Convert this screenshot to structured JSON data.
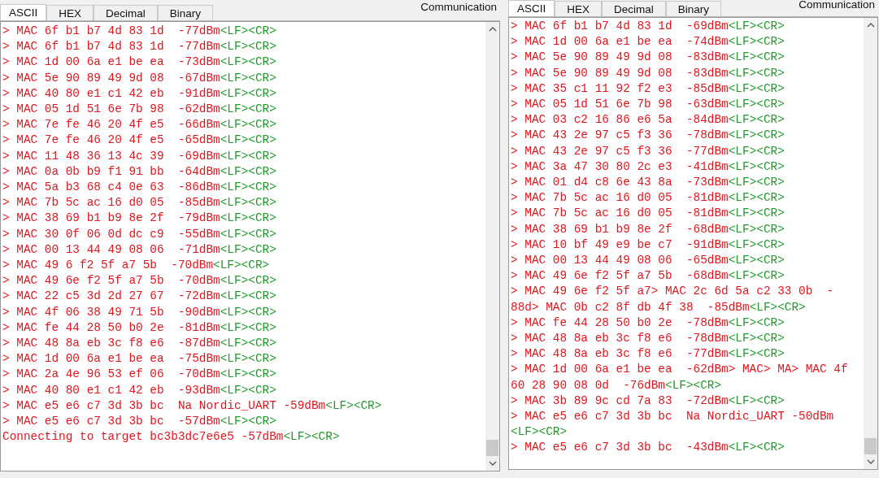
{
  "panels": [
    {
      "tabs": [
        {
          "label": "ASCII",
          "selected": true
        },
        {
          "label": "HEX",
          "selected": false
        },
        {
          "label": "Decimal",
          "selected": false
        },
        {
          "label": "Binary",
          "selected": false
        }
      ],
      "label": "Communication",
      "lines": [
        {
          "text": "> MAC 6f b1 b7 4d 83 1d  -77dBm",
          "end": "<LF><CR>"
        },
        {
          "text": "> MAC 6f b1 b7 4d 83 1d  -77dBm",
          "end": "<LF><CR>"
        },
        {
          "text": "> MAC 1d 00 6a e1 be ea  -73dBm",
          "end": "<LF><CR>"
        },
        {
          "text": "> MAC 5e 90 89 49 9d 08  -67dBm",
          "end": "<LF><CR>"
        },
        {
          "text": "> MAC 40 80 e1 c1 42 eb  -91dBm",
          "end": "<LF><CR>"
        },
        {
          "text": "> MAC 05 1d 51 6e 7b 98  -62dBm",
          "end": "<LF><CR>"
        },
        {
          "text": "> MAC 7e fe 46 20 4f e5  -66dBm",
          "end": "<LF><CR>"
        },
        {
          "text": "> MAC 7e fe 46 20 4f e5  -65dBm",
          "end": "<LF><CR>"
        },
        {
          "text": "> MAC 11 48 36 13 4c 39  -69dBm",
          "end": "<LF><CR>"
        },
        {
          "text": "> MAC 0a 0b b9 f1 91 bb  -64dBm",
          "end": "<LF><CR>"
        },
        {
          "text": "> MAC 5a b3 68 c4 0e 63  -86dBm",
          "end": "<LF><CR>"
        },
        {
          "text": "> MAC 7b 5c ac 16 d0 05  -85dBm",
          "end": "<LF><CR>"
        },
        {
          "text": "> MAC 38 69 b1 b9 8e 2f  -79dBm",
          "end": "<LF><CR>"
        },
        {
          "text": "> MAC 30 0f 06 0d dc c9  -55dBm",
          "end": "<LF><CR>"
        },
        {
          "text": "> MAC 00 13 44 49 08 06  -71dBm",
          "end": "<LF><CR>"
        },
        {
          "text": "> MAC 49 6 f2 5f a7 5b  -70dBm",
          "end": "<LF><CR>"
        },
        {
          "text": "> MAC 49 6e f2 5f a7 5b  -70dBm",
          "end": "<LF><CR>"
        },
        {
          "text": "> MAC 22 c5 3d 2d 27 67  -72dBm",
          "end": "<LF><CR>"
        },
        {
          "text": "> MAC 4f 06 38 49 71 5b  -90dBm",
          "end": "<LF><CR>"
        },
        {
          "text": "> MAC fe 44 28 50 b0 2e  -81dBm",
          "end": "<LF><CR>"
        },
        {
          "text": "> MAC 48 8a eb 3c f8 e6  -87dBm",
          "end": "<LF><CR>"
        },
        {
          "text": "> MAC 1d 00 6a e1 be ea  -75dBm",
          "end": "<LF><CR>"
        },
        {
          "text": "> MAC 2a 4e 96 53 ef 06  -70dBm",
          "end": "<LF><CR>"
        },
        {
          "text": "> MAC 40 80 e1 c1 42 eb  -93dBm",
          "end": "<LF><CR>"
        },
        {
          "text": "> MAC e5 e6 c7 3d 3b bc  Na Nordic_UART -59dBm",
          "end": "<LF><CR>"
        },
        {
          "text": "> MAC e5 e6 c7 3d 3b bc  -57dBm",
          "end": "<LF><CR>"
        },
        {
          "text": "Connecting to target bc3b3dc7e6e5 -57dBm",
          "end": "<LF><CR>"
        }
      ]
    },
    {
      "tabs": [
        {
          "label": "ASCII",
          "selected": true
        },
        {
          "label": "HEX",
          "selected": false
        },
        {
          "label": "Decimal",
          "selected": false
        },
        {
          "label": "Binary",
          "selected": false
        }
      ],
      "label": "Communication",
      "lines": [
        {
          "text": "> MAC 6f b1 b7 4d 83 1d  -69dBm",
          "end": "<LF><CR>"
        },
        {
          "text": "> MAC 1d 00 6a e1 be ea  -74dBm",
          "end": "<LF><CR>"
        },
        {
          "text": "> MAC 5e 90 89 49 9d 08  -83dBm",
          "end": "<LF><CR>"
        },
        {
          "text": "> MAC 5e 90 89 49 9d 08  -83dBm",
          "end": "<LF><CR>"
        },
        {
          "text": "> MAC 35 c1 11 92 f2 e3  -85dBm",
          "end": "<LF><CR>"
        },
        {
          "text": "> MAC 05 1d 51 6e 7b 98  -63dBm",
          "end": "<LF><CR>"
        },
        {
          "text": "> MAC 03 c2 16 86 e6 5a  -84dBm",
          "end": "<LF><CR>"
        },
        {
          "text": "> MAC 43 2e 97 c5 f3 36  -78dBm",
          "end": "<LF><CR>"
        },
        {
          "text": "> MAC 43 2e 97 c5 f3 36  -77dBm",
          "end": "<LF><CR>"
        },
        {
          "text": "> MAC 3a 47 30 80 2c e3  -41dBm",
          "end": "<LF><CR>"
        },
        {
          "text": "> MAC 01 d4 c8 6e 43 8a  -73dBm",
          "end": "<LF><CR>"
        },
        {
          "text": "> MAC 7b 5c ac 16 d0 05  -81dBm",
          "end": "<LF><CR>"
        },
        {
          "text": "> MAC 7b 5c ac 16 d0 05  -81dBm",
          "end": "<LF><CR>"
        },
        {
          "text": "> MAC 38 69 b1 b9 8e 2f  -68dBm",
          "end": "<LF><CR>"
        },
        {
          "text": "> MAC 10 bf 49 e9 be c7  -91dBm",
          "end": "<LF><CR>"
        },
        {
          "text": "> MAC 00 13 44 49 08 06  -65dBm",
          "end": "<LF><CR>"
        },
        {
          "text": "> MAC 49 6e f2 5f a7 5b  -68dBm",
          "end": "<LF><CR>"
        },
        {
          "text": "> MAC 49 6e f2 5f a7> MAC 2c 6d 5a c2 33 0b  -"
        },
        {
          "text": "88d> MAC 0b c2 8f db 4f 38  -85dBm",
          "end": "<LF><CR>"
        },
        {
          "text": "> MAC fe 44 28 50 b0 2e  -78dBm",
          "end": "<LF><CR>"
        },
        {
          "text": "> MAC 48 8a eb 3c f8 e6  -78dBm",
          "end": "<LF><CR>"
        },
        {
          "text": "> MAC 48 8a eb 3c f8 e6  -77dBm",
          "end": "<LF><CR>"
        },
        {
          "text": "> MAC 1d 00 6a e1 be ea  -62dBm> MAC> MA> MAC 4f"
        },
        {
          "text": "60 28 90 08 0d  -76dBm",
          "end": "<LF><CR>"
        },
        {
          "text": "> MAC 3b 89 9c cd 7a 83  -72dBm",
          "end": "<LF><CR>"
        },
        {
          "text": "> MAC e5 e6 c7 3d 3b bc  Na Nordic_UART -50dBm"
        },
        {
          "end": "<LF><CR>"
        },
        {
          "text": "> MAC e5 e6 c7 3d 3b bc  -43dBm",
          "end": "<LF><CR>"
        }
      ]
    }
  ]
}
